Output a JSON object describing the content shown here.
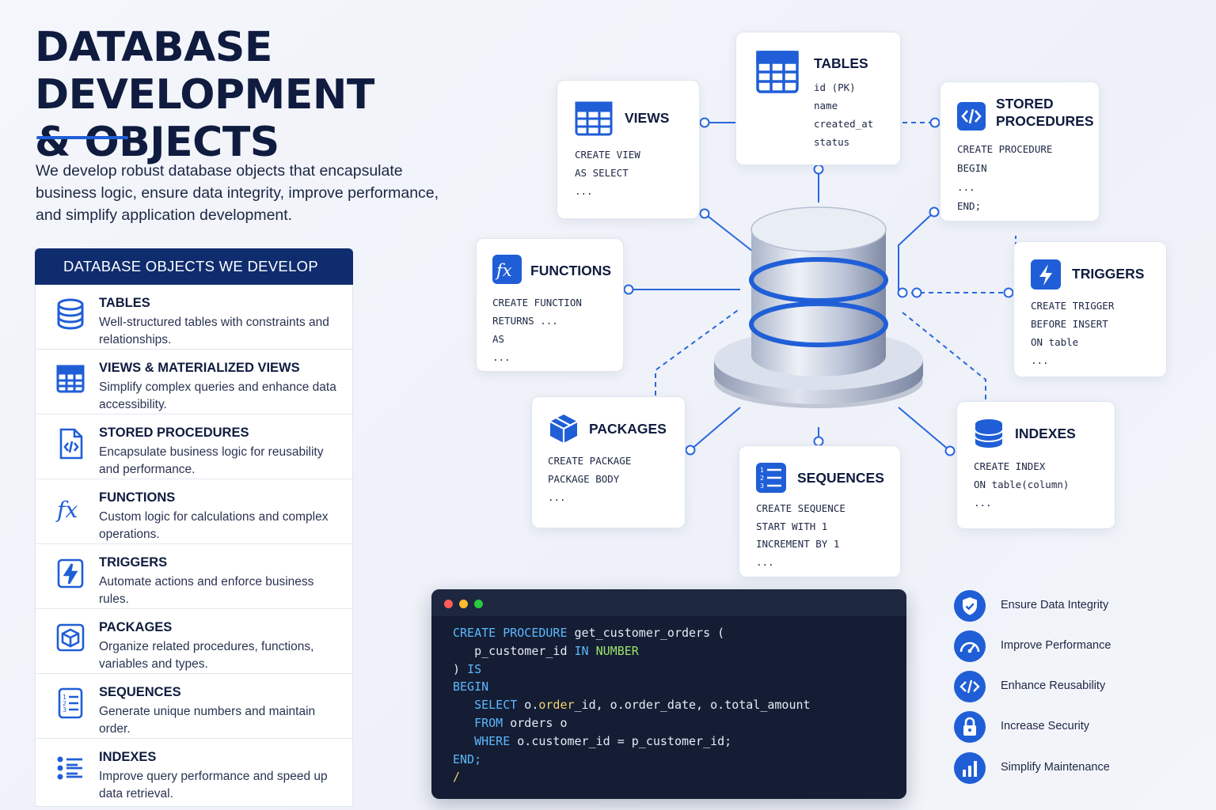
{
  "header": {
    "title_line1": "DATABASE DEVELOPMENT",
    "title_line2": "& OBJECTS",
    "intro": "We develop robust database objects that encapsulate business logic, ensure data integrity, improve performance, and simplify application development."
  },
  "panel": {
    "heading": "DATABASE OBJECTS WE DEVELOP",
    "items": [
      {
        "title": "TABLES",
        "desc": "Well-structured tables with constraints and relationships.",
        "icon": "database-icon"
      },
      {
        "title": "VIEWS & MATERIALIZED VIEWS",
        "desc": "Simplify complex queries and enhance data accessibility.",
        "icon": "grid-icon"
      },
      {
        "title": "STORED PROCEDURES",
        "desc": "Encapsulate business logic for reusability and performance.",
        "icon": "code-file-icon"
      },
      {
        "title": "FUNCTIONS",
        "desc": "Custom logic for calculations and complex operations.",
        "icon": "function-icon"
      },
      {
        "title": "TRIGGERS",
        "desc": "Automate actions and enforce business rules.",
        "icon": "lightning-icon"
      },
      {
        "title": "PACKAGES",
        "desc": "Organize related procedures, functions, variables and types.",
        "icon": "package-icon"
      },
      {
        "title": "SEQUENCES",
        "desc": "Generate unique numbers and maintain order.",
        "icon": "numbered-list-icon"
      },
      {
        "title": "INDEXES",
        "desc": "Improve query performance and speed up data retrieval.",
        "icon": "index-list-icon"
      }
    ]
  },
  "diagram": {
    "cards": {
      "tables": {
        "title": "TABLES",
        "lines": [
          "id (PK)",
          "name",
          "created_at",
          "status"
        ]
      },
      "views": {
        "title": "VIEWS",
        "lines": [
          "CREATE VIEW",
          "AS SELECT",
          "..."
        ]
      },
      "procedures": {
        "title_line1": "STORED",
        "title_line2": "PROCEDURES",
        "lines": [
          "CREATE PROCEDURE",
          "BEGIN",
          "...",
          "END;"
        ]
      },
      "functions": {
        "title": "FUNCTIONS",
        "lines": [
          "CREATE FUNCTION",
          "RETURNS ...",
          "AS",
          "..."
        ]
      },
      "triggers": {
        "title": "TRIGGERS",
        "lines": [
          "CREATE TRIGGER",
          "BEFORE INSERT",
          "ON table",
          "..."
        ]
      },
      "packages": {
        "title": "PACKAGES",
        "lines": [
          "CREATE PACKAGE",
          "PACKAGE BODY",
          "..."
        ]
      },
      "sequences": {
        "title": "SEQUENCES",
        "lines": [
          "CREATE SEQUENCE",
          "START WITH 1",
          "INCREMENT BY 1",
          "..."
        ]
      },
      "indexes": {
        "title": "INDEXES",
        "lines": [
          "CREATE INDEX",
          "ON table(column)",
          "..."
        ]
      }
    }
  },
  "code": {
    "l1_kw": "CREATE PROCEDURE",
    "l1_rest": " get_customer_orders (",
    "l2_id": "   p_customer_id ",
    "l2_kw": "IN",
    "l2_sp": " ",
    "l2_ty": "NUMBER",
    "l3_a": ") ",
    "l3_kw": "IS",
    "l4": "BEGIN",
    "l5_kw": "   SELECT",
    "l5_sp": " o.",
    "l5_id": "order",
    "l5_rest": "_id, o.order_date, o.total_amount",
    "l6_kw": "   FROM",
    "l6_rest": " orders o",
    "l7_kw": "   WHERE",
    "l7_rest": " o.customer_id = p_customer_id;",
    "l8": "END;",
    "l9": "/"
  },
  "benefits": [
    {
      "label": "Ensure Data Integrity",
      "icon": "shield-check-icon"
    },
    {
      "label": "Improve Performance",
      "icon": "gauge-icon"
    },
    {
      "label": "Enhance Reusability",
      "icon": "code-icon"
    },
    {
      "label": "Increase Security",
      "icon": "lock-icon"
    },
    {
      "label": "Simplify Maintenance",
      "icon": "bar-chart-icon"
    }
  ],
  "colors": {
    "accent": "#1f5ed6",
    "navy": "#0f2c6e",
    "editor_bg": "#141d33"
  }
}
